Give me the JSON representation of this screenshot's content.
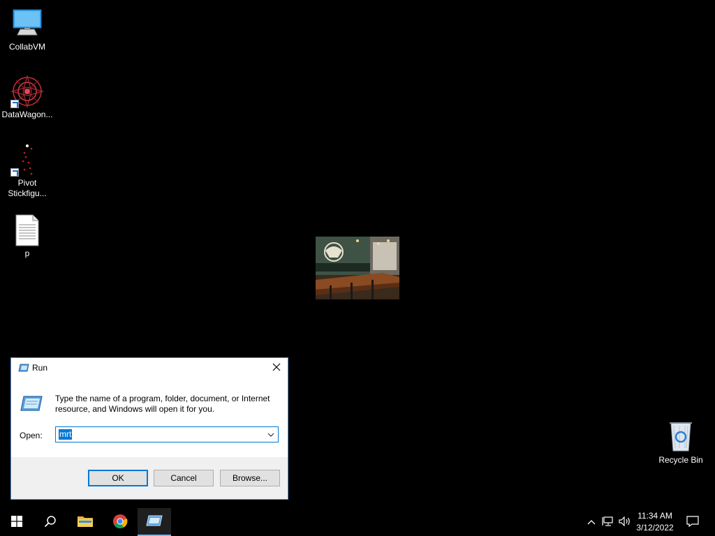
{
  "desktop": {
    "icons": [
      {
        "label": "CollabVM",
        "icon": "monitor-icon"
      },
      {
        "label": "DataWagon...",
        "icon": "datawagon-icon"
      },
      {
        "label": "Pivot Stickfigu...",
        "icon": "stickfigure-icon"
      },
      {
        "label": "p",
        "icon": "text-file-icon"
      },
      {
        "label": "Recycle Bin",
        "icon": "recycle-bin-icon"
      }
    ]
  },
  "run_dialog": {
    "title": "Run",
    "description": "Type the name of a program, folder, document, or Internet resource, and Windows will open it for you.",
    "open_label": "Open:",
    "open_value": "mrt",
    "buttons": {
      "ok": "OK",
      "cancel": "Cancel",
      "browse": "Browse..."
    }
  },
  "taskbar": {
    "items": [
      "start-icon",
      "search-icon",
      "file-explorer-icon",
      "chrome-icon",
      "run-icon"
    ],
    "clock": {
      "time": "11:34 AM",
      "date": "3/12/2022"
    }
  },
  "colors": {
    "accent": "#0078d7",
    "desktop_bg": "#000000",
    "dialog_footer": "#f0f0f0"
  }
}
